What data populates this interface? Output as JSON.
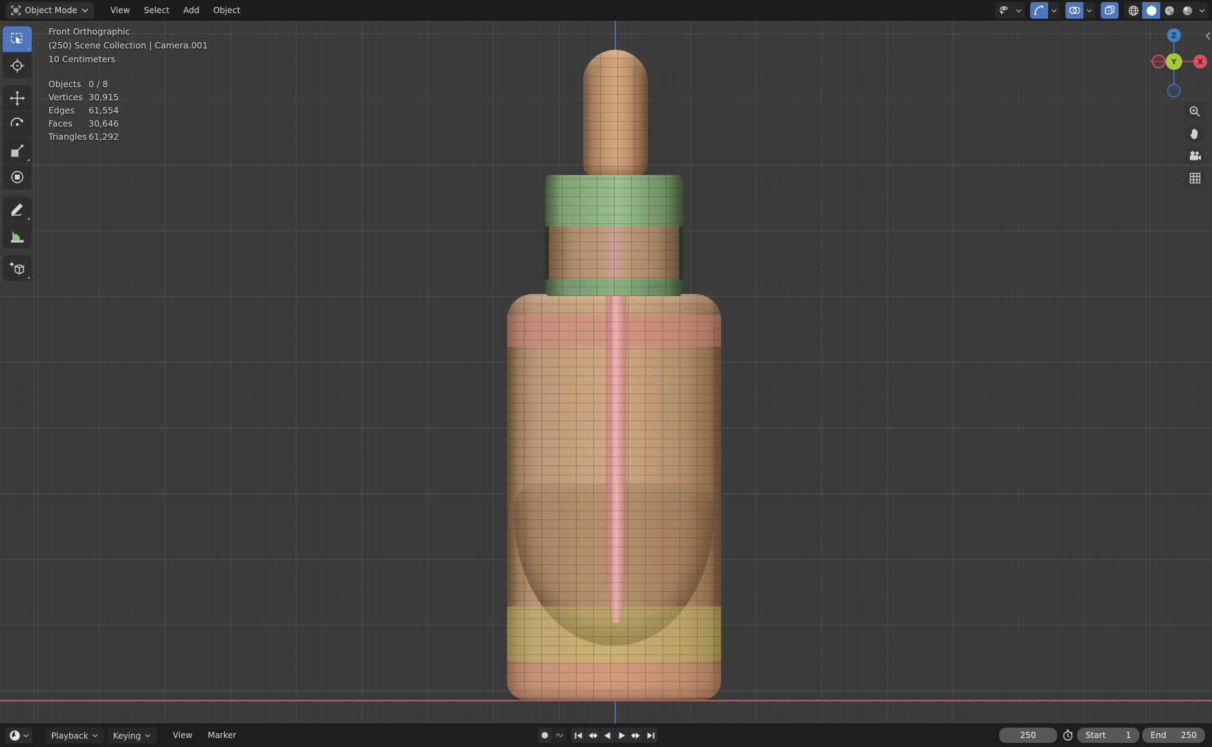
{
  "header": {
    "mode": {
      "label": "Object Mode"
    },
    "menus": [
      {
        "label": "View"
      },
      {
        "label": "Select"
      },
      {
        "label": "Add"
      },
      {
        "label": "Object"
      }
    ],
    "toggles": [
      "object-type-visibility",
      "show-gizmos",
      "show-overlays",
      "toggle-xray",
      "shading-wireframe",
      "shading-solid",
      "shading-material",
      "shading-rendered"
    ],
    "active_shading": "solid"
  },
  "viewport": {
    "info": {
      "view": "Front Orthographic",
      "scene": "(250) Scene Collection | Camera.001",
      "scale": "10 Centimeters"
    },
    "stats": [
      {
        "label": "Objects",
        "value": "0 / 8"
      },
      {
        "label": "Vertices",
        "value": "30,915"
      },
      {
        "label": "Edges",
        "value": "61,554"
      },
      {
        "label": "Faces",
        "value": "30,646"
      },
      {
        "label": "Triangles",
        "value": "61,292"
      }
    ],
    "gizmo": {
      "z": "Z",
      "y": "Y",
      "x": "X"
    },
    "tools": [
      "select-box",
      "cursor",
      "move",
      "rotate",
      "scale",
      "transform",
      "annotate",
      "measure",
      "add-cube"
    ],
    "active_tool": "select-box"
  },
  "timeline": {
    "menus": [
      {
        "label": "Playback"
      },
      {
        "label": "Keying"
      },
      {
        "label": "View"
      },
      {
        "label": "Marker"
      }
    ],
    "frame_current": "250",
    "start_label": "Start",
    "start_value": "1",
    "end_label": "End",
    "end_value": "250"
  },
  "colors": {
    "accent_blue": "#4f76b8",
    "axis_x_red": "#c96069",
    "axis_z_blue": "#5472b0",
    "gizmo_x": "#dd4f62",
    "gizmo_y": "#a9c93d",
    "gizmo_z": "#3d83c8",
    "cap_green": "#93b988",
    "bottle_tan": "#c6a07c",
    "pipette_pink": "#e8a2a4",
    "band_yellow": "#c6bc64",
    "viewport_bg": "#3b3b3b",
    "bar_bg": "#1e1e1e"
  }
}
